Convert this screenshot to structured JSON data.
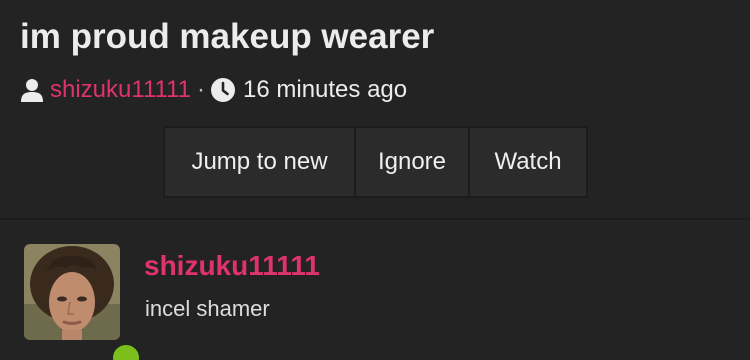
{
  "thread": {
    "title": "im proud makeup wearer",
    "author": "shizuku11111",
    "separator": "·",
    "posted_time": "16 minutes ago",
    "icons": {
      "user": "user-icon",
      "clock": "clock-icon"
    }
  },
  "actions": {
    "jump_label": "Jump to new",
    "ignore_label": "Ignore",
    "watch_label": "Watch"
  },
  "post": {
    "username": "shizuku11111",
    "user_title": "incel shamer",
    "avatar_alt": "avatar",
    "online_status_color": "#7cbf1c"
  },
  "colors": {
    "background": "#232323",
    "accent": "#e0336d",
    "button_bg": "#2b2b2b"
  }
}
